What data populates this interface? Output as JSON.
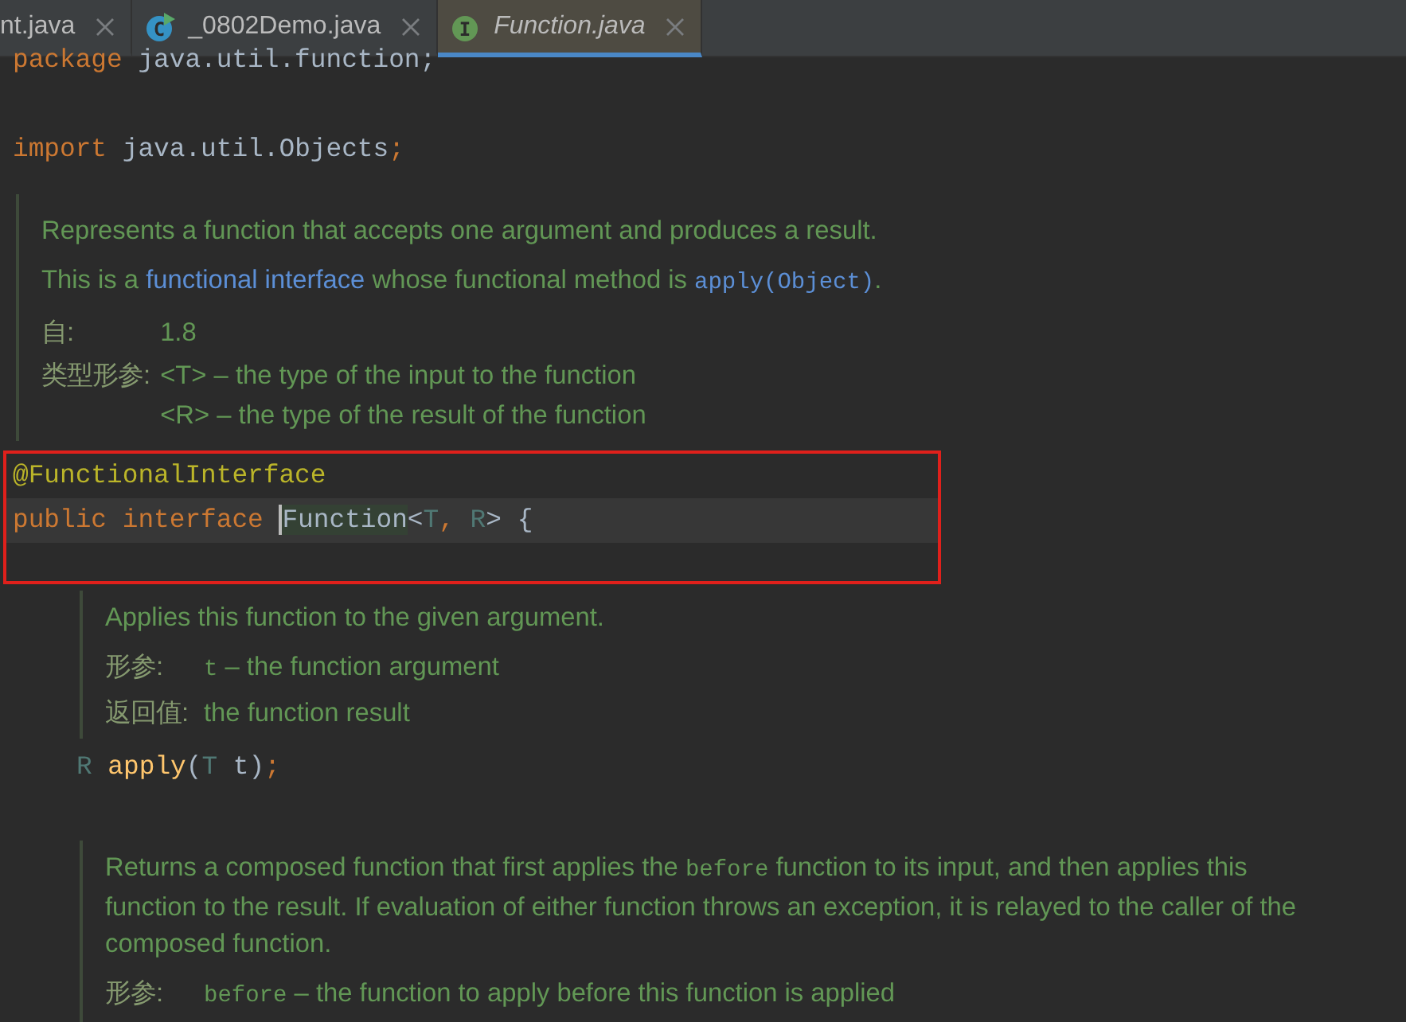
{
  "tabs": [
    {
      "label": "nt.java",
      "selected": false
    },
    {
      "label": "_0802Demo.java",
      "selected": false,
      "icon": {
        "kind": "runnable-class",
        "letter": "C"
      }
    },
    {
      "label": "Function.java",
      "selected": true,
      "icon": {
        "kind": "interface",
        "letter": "I"
      }
    }
  ],
  "editor": {
    "blocks": [
      {
        "kind": "code",
        "tokens": [
          {
            "text": "package",
            "kind": "keyword"
          },
          {
            "text": " java.util.function;",
            "kind": "plain"
          }
        ]
      },
      {
        "kind": "blank"
      },
      {
        "kind": "code",
        "tokens": [
          {
            "text": "import",
            "kind": "keyword"
          },
          {
            "text": " java.util.Objects",
            "kind": "plain"
          },
          {
            "text": ";",
            "kind": "keyword"
          }
        ]
      },
      {
        "kind": "doc",
        "member": false,
        "paragraphs": [
          [
            {
              "text": "Represents a function that accepts one argument and produces a result.",
              "kind": "text"
            }
          ],
          [
            {
              "text": "This is a ",
              "kind": "text"
            },
            {
              "text": "functional interface",
              "kind": "link"
            },
            {
              "text": " whose functional method is ",
              "kind": "text"
            },
            {
              "text": "apply(Object)",
              "kind": "code-link"
            },
            {
              "text": ".",
              "kind": "text"
            }
          ]
        ],
        "tags": [
          {
            "label": "自:",
            "values": [
              [
                {
                  "text": "1.8",
                  "kind": "text"
                }
              ]
            ]
          },
          {
            "label": "类型形参:",
            "values": [
              [
                {
                  "text": "<T>",
                  "kind": "text"
                },
                {
                  "text": " – the type of the input to the function",
                  "kind": "text"
                }
              ],
              [
                {
                  "text": "<R>",
                  "kind": "text"
                },
                {
                  "text": " – the type of the result of the function",
                  "kind": "text"
                }
              ]
            ]
          }
        ]
      },
      {
        "kind": "highlight",
        "lines": [
          {
            "current": false,
            "tokens": [
              {
                "text": "@FunctionalInterface",
                "kind": "annotation"
              }
            ]
          },
          {
            "current": true,
            "tokens": [
              {
                "text": "public interface ",
                "kind": "keyword"
              },
              {
                "text": "Function",
                "kind": "plain",
                "caret": true
              },
              {
                "text": "<",
                "kind": "plain"
              },
              {
                "text": "T",
                "kind": "typeparam"
              },
              {
                "text": ", ",
                "kind": "keyword"
              },
              {
                "text": "R",
                "kind": "typeparam"
              },
              {
                "text": "> {",
                "kind": "plain"
              }
            ]
          }
        ]
      },
      {
        "kind": "doc",
        "member": true,
        "paragraphs": [
          [
            {
              "text": "Applies this function to the given argument.",
              "kind": "text"
            }
          ]
        ],
        "tags": [
          {
            "label": "形参:",
            "values": [
              [
                {
                  "text": "t",
                  "kind": "code"
                },
                {
                  "text": " – the function argument",
                  "kind": "text"
                }
              ]
            ]
          },
          {
            "label": "返回值:",
            "values": [
              [
                {
                  "text": "the function result",
                  "kind": "text"
                }
              ]
            ]
          }
        ]
      },
      {
        "kind": "code",
        "member": true,
        "tokens": [
          {
            "text": "R",
            "kind": "typeparam"
          },
          {
            "text": " apply",
            "kind": "method"
          },
          {
            "text": "(",
            "kind": "plain"
          },
          {
            "text": "T",
            "kind": "typeparam"
          },
          {
            "text": " t)",
            "kind": "plain"
          },
          {
            "text": ";",
            "kind": "keyword"
          }
        ]
      },
      {
        "kind": "blank"
      },
      {
        "kind": "doc",
        "member": true,
        "paragraphs": [
          [
            {
              "text": "Returns a composed function that first applies the ",
              "kind": "text"
            },
            {
              "text": "before",
              "kind": "code"
            },
            {
              "text": " function to its input, and then applies this function to the result. If evaluation of either function throws an exception, it is relayed to the caller of the composed function.",
              "kind": "text"
            }
          ]
        ],
        "tags": [
          {
            "label": "形参:",
            "values": [
              [
                {
                  "text": "before",
                  "kind": "code"
                },
                {
                  "text": " – the function to apply before this function is applied",
                  "kind": "text"
                }
              ]
            ]
          }
        ]
      }
    ]
  }
}
